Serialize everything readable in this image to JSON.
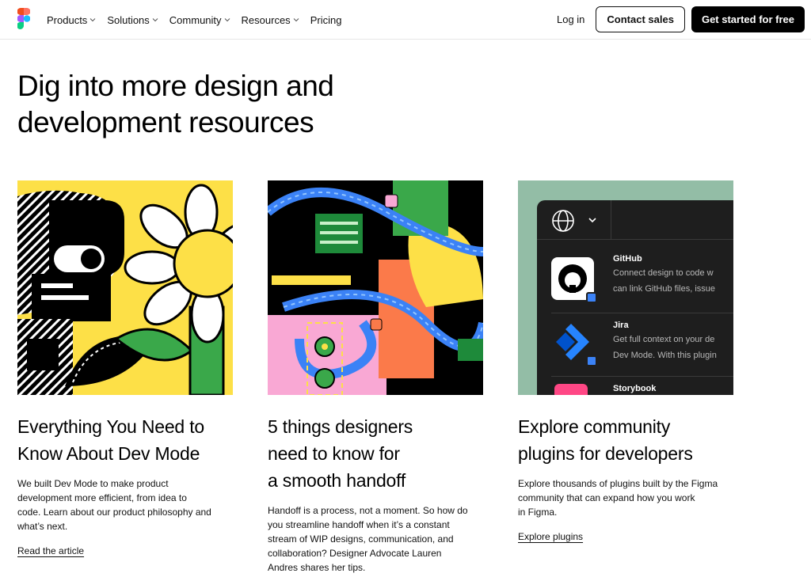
{
  "nav": {
    "links": [
      {
        "label": "Products",
        "has_menu": true
      },
      {
        "label": "Solutions",
        "has_menu": true
      },
      {
        "label": "Community",
        "has_menu": true
      },
      {
        "label": "Resources",
        "has_menu": true
      },
      {
        "label": "Pricing",
        "has_menu": false
      }
    ],
    "login": "Log in",
    "contact": "Contact sales",
    "get_started": "Get started for free"
  },
  "hero": {
    "title_line1": "Dig into more design and",
    "title_line2": "development resources"
  },
  "cards": [
    {
      "title_lines": [
        "Everything You Need to",
        "Know About Dev Mode"
      ],
      "desc_lines": [
        "We built Dev Mode to make product",
        "development more efficient, from idea to",
        "code. Learn about our product philosophy and",
        "what’s next."
      ],
      "link": "Read the article"
    },
    {
      "title_lines": [
        "5 things designers",
        "need to know for",
        "a smooth handoff"
      ],
      "desc_lines": [
        "Handoff is a process, not a moment. So how do",
        "you streamline handoff when it’s a constant",
        "stream of WIP designs, communication, and",
        "collaboration? Designer Advocate Lauren",
        "Andres shares her tips."
      ],
      "link": ""
    },
    {
      "title_lines": [
        "Explore community",
        "plugins for developers"
      ],
      "desc_lines": [
        "Explore thousands of plugins built by the Figma",
        "community that can expand how you work",
        "in Figma."
      ],
      "link": "Explore plugins",
      "plugins": [
        {
          "name": "GitHub",
          "desc_lines": [
            "Connect design to code w",
            "can link GitHub files, issue"
          ]
        },
        {
          "name": "Jira",
          "desc_lines": [
            "Get full context on your de",
            "Dev Mode. With this plugin"
          ]
        },
        {
          "name": "Storybook",
          "desc_lines": []
        }
      ]
    }
  ],
  "colors": {
    "accent_dark": "#000000",
    "card1_bg": "#fde047",
    "card3_bg": "#93bda6",
    "mock_panel": "#1e1e1e"
  }
}
